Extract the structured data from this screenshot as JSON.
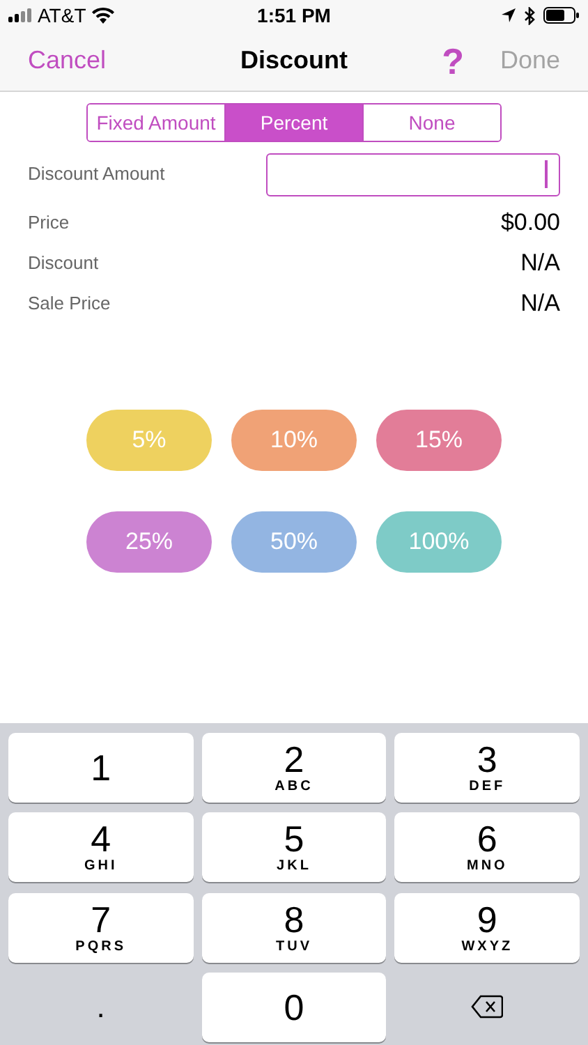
{
  "status_bar": {
    "carrier": "AT&T",
    "time": "1:51 PM"
  },
  "nav": {
    "cancel": "Cancel",
    "title": "Discount",
    "help": "?",
    "done": {
      "label": "Done",
      "disabled": true
    }
  },
  "segments": [
    {
      "label": "Fixed Amount",
      "selected": false
    },
    {
      "label": "Percent",
      "selected": true
    },
    {
      "label": "None",
      "selected": false
    }
  ],
  "discount_amount": {
    "label": "Discount Amount",
    "focused": true
  },
  "summary": [
    {
      "label": "Price",
      "value": "$0.00"
    },
    {
      "label": "Discount",
      "value": "N/A"
    },
    {
      "label": "Sale Price",
      "value": "N/A"
    }
  ],
  "presets": [
    {
      "label": "5%",
      "color": "#eed15f"
    },
    {
      "label": "10%",
      "color": "#f0a276"
    },
    {
      "label": "15%",
      "color": "#e27d98"
    },
    {
      "label": "25%",
      "color": "#cc83d2"
    },
    {
      "label": "50%",
      "color": "#93b5e2"
    },
    {
      "label": "100%",
      "color": "#7ecbc7"
    }
  ],
  "keypad": [
    {
      "kind": "digit",
      "digit": "1"
    },
    {
      "kind": "digit",
      "digit": "2",
      "letters": "ABC"
    },
    {
      "kind": "digit",
      "digit": "3",
      "letters": "DEF"
    },
    {
      "kind": "digit",
      "digit": "4",
      "letters": "GHI"
    },
    {
      "kind": "digit",
      "digit": "5",
      "letters": "JKL"
    },
    {
      "kind": "digit",
      "digit": "6",
      "letters": "MNO"
    },
    {
      "kind": "digit",
      "digit": "7",
      "letters": "PQRS"
    },
    {
      "kind": "digit",
      "digit": "8",
      "letters": "TUV"
    },
    {
      "kind": "digit",
      "digit": "9",
      "letters": "WXYZ"
    },
    {
      "kind": "dot",
      "digit": "."
    },
    {
      "kind": "digit",
      "digit": "0"
    },
    {
      "kind": "backspace"
    }
  ]
}
